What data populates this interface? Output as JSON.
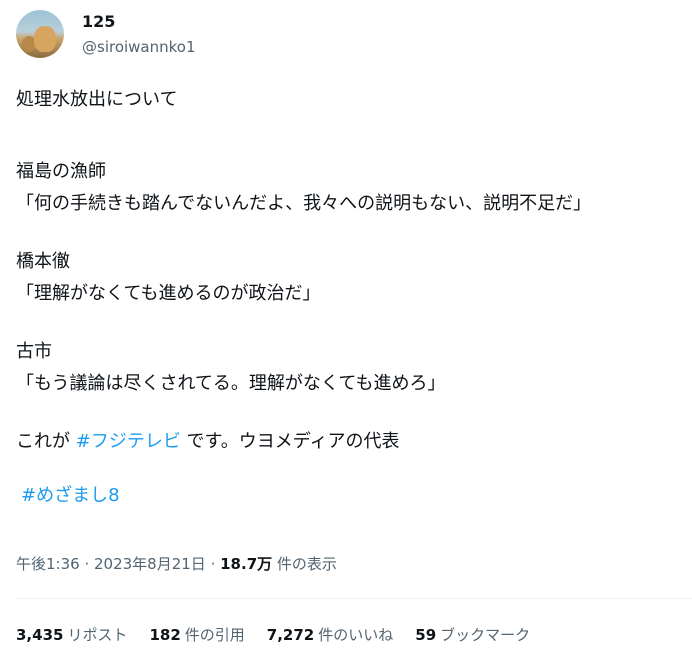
{
  "author": {
    "name": "125",
    "handle": "@siroiwannko1"
  },
  "tweet": {
    "line1": "処理水放出について",
    "line2": "福島の漁師",
    "line3": "「何の手続きも踏んでないんだよ、我々への説明もない、説明不足だ」",
    "line4": "橋本徹",
    "line5": "「理解がなくても進めるのが政治だ」",
    "line6": "古市",
    "line7": "「もう議論は尽くされてる。理解がなくても進めろ」",
    "line8_pre": "これが ",
    "line8_hashtag": "#フジテレビ",
    "line8_post": " です。ウヨメディアの代表",
    "hashtag2": "#めざまし8"
  },
  "meta": {
    "time": "午後1:36",
    "sep1": " · ",
    "date": "2023年8月21日",
    "sep2": " · ",
    "views": "18.7万",
    "views_label": " 件の表示"
  },
  "stats": {
    "reposts_count": "3,435",
    "reposts_label": "リポスト",
    "quotes_count": "182",
    "quotes_label": "件の引用",
    "likes_count": "7,272",
    "likes_label": "件のいいね",
    "bookmarks_count": "59",
    "bookmarks_label": "ブックマーク"
  }
}
